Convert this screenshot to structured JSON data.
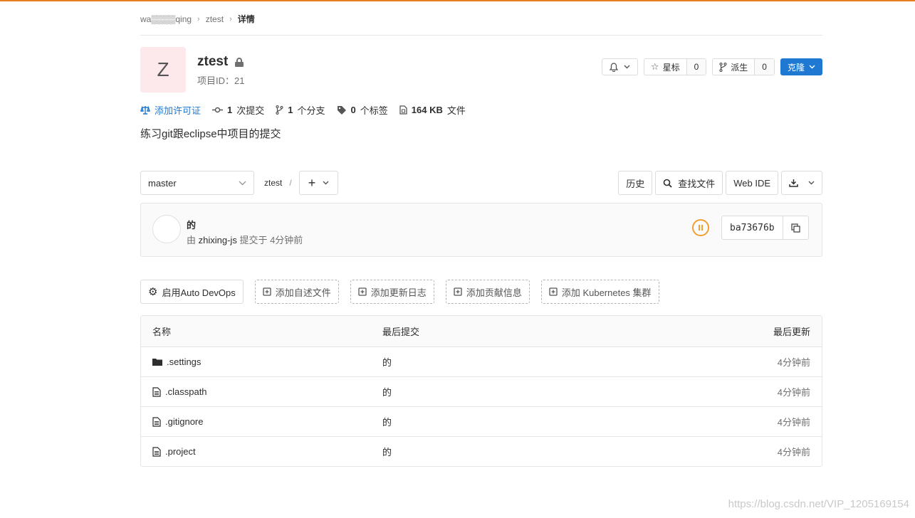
{
  "breadcrumb": {
    "owner": "wa▒▒▒▒qing",
    "project": "ztest",
    "current": "详情"
  },
  "project": {
    "avatar_letter": "Z",
    "name": "ztest",
    "id_text": "项目ID：21",
    "description": "练习git跟eclipse中项目的提交"
  },
  "actions": {
    "star_label": "星标",
    "star_count": "0",
    "fork_label": "派生",
    "fork_count": "0",
    "clone_label": "克隆"
  },
  "stats": {
    "license": "添加许可证",
    "commits_num": "1",
    "commits_label": "次提交",
    "branches_num": "1",
    "branches_label": "个分支",
    "tags_num": "0",
    "tags_label": "个标签",
    "size_num": "164 KB",
    "size_label": "文件"
  },
  "toolbar": {
    "branch": "master",
    "path": "ztest",
    "history": "历史",
    "find_file": "查找文件",
    "web_ide": "Web IDE"
  },
  "commit": {
    "title": "的",
    "meta_prefix": "由",
    "author": "zhixing-js",
    "meta_suffix": "提交于 4分钟前",
    "sha": "ba73676b"
  },
  "quick_actions": {
    "auto_devops": "启用Auto DevOps",
    "readme": "添加自述文件",
    "changelog": "添加更新日志",
    "contributing": "添加贡献信息",
    "kubernetes": "添加 Kubernetes 集群"
  },
  "tree": {
    "headers": [
      "名称",
      "最后提交",
      "最后更新"
    ],
    "rows": [
      {
        "name": ".settings",
        "commit": "的",
        "updated": "4分钟前"
      },
      {
        "name": ".classpath",
        "commit": "的",
        "updated": "4分钟前"
      },
      {
        "name": ".gitignore",
        "commit": "的",
        "updated": "4分钟前"
      },
      {
        "name": ".project",
        "commit": "的",
        "updated": "4分钟前"
      }
    ]
  },
  "watermark": "https://blog.csdn.net/VIP_1205169154",
  "colors": {
    "accent": "#1f78d1",
    "topbar": "#e67e22",
    "pipeline": "#f0a030"
  }
}
